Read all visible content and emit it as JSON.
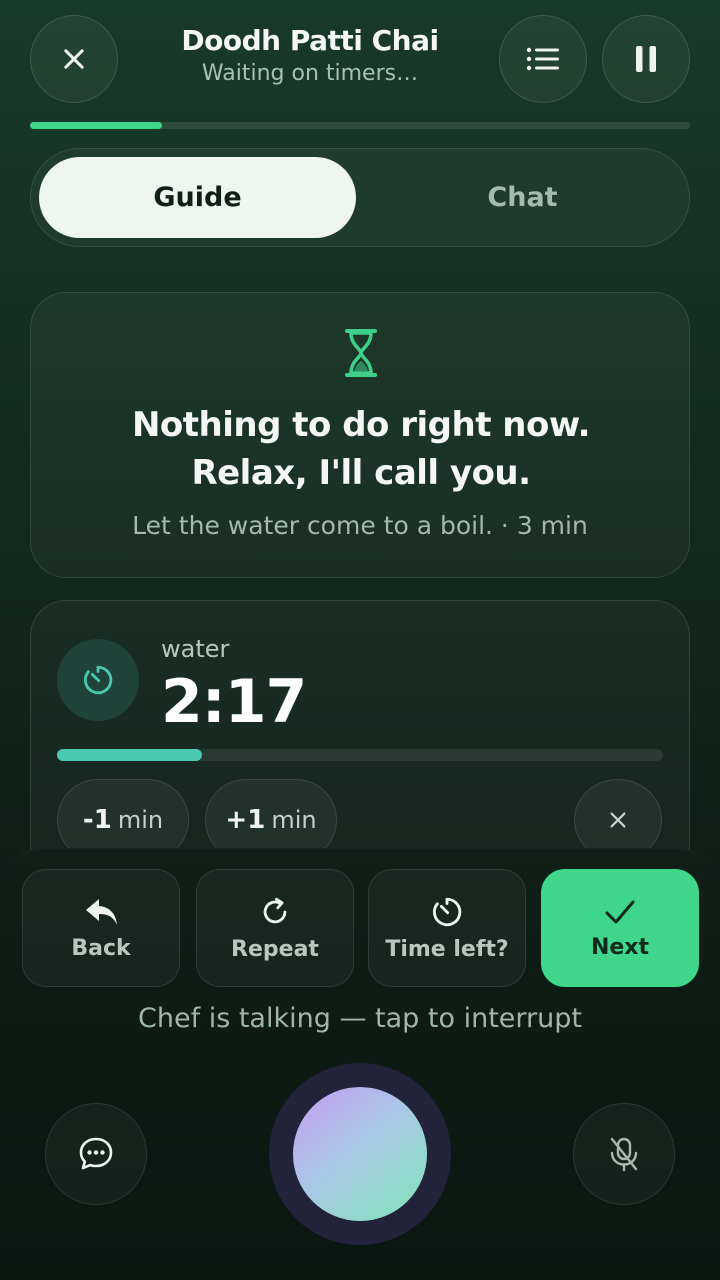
{
  "header": {
    "title": "Doodh Patti Chai",
    "subtitle": "Waiting on timers…",
    "progress": 0.2
  },
  "tabs": [
    {
      "label": "Guide",
      "active": true
    },
    {
      "label": "Chat",
      "active": false
    }
  ],
  "status_card": {
    "icon": "hourglass-icon",
    "title": "Nothing to do right now. Relax, I'll call you.",
    "subtitle": "Let the water come to a boil. · 3 min"
  },
  "timer": {
    "icon": "timer-icon",
    "label": "water",
    "time": "2:17",
    "progress": 0.24,
    "minus": {
      "num": "-1",
      "unit": "min"
    },
    "plus": {
      "num": "+1",
      "unit": "min"
    }
  },
  "actions": [
    {
      "label": "Back",
      "icon": "reply-arrow-icon"
    },
    {
      "label": "Repeat",
      "icon": "repeat-icon"
    },
    {
      "label": "Time left?",
      "icon": "timer-icon"
    },
    {
      "label": "Next",
      "icon": "check-icon"
    }
  ],
  "talk_hint": "Chef is talking — tap to interrupt",
  "colors": {
    "accent": "#3fd68b",
    "timer_fill": "#49c9b0",
    "orb_start": "#c79bf3",
    "orb_end": "#7fe6b8"
  }
}
